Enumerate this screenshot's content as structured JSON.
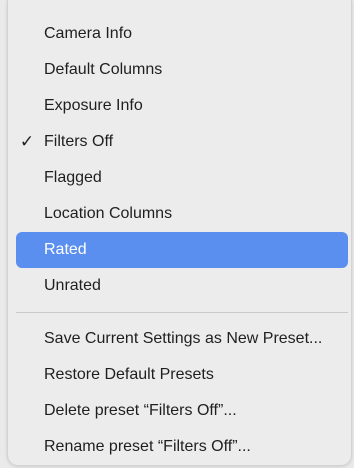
{
  "menu": {
    "section1": [
      {
        "label": "Camera Info",
        "checked": false
      },
      {
        "label": "Default Columns",
        "checked": false
      },
      {
        "label": "Exposure Info",
        "checked": false
      },
      {
        "label": "Filters Off",
        "checked": true
      },
      {
        "label": "Flagged",
        "checked": false
      },
      {
        "label": "Location Columns",
        "checked": false
      },
      {
        "label": "Rated",
        "checked": false,
        "highlighted": true
      },
      {
        "label": "Unrated",
        "checked": false
      }
    ],
    "section2": [
      {
        "label": "Save Current Settings as New Preset..."
      },
      {
        "label": "Restore Default Presets"
      },
      {
        "label": "Delete preset “Filters Off”..."
      },
      {
        "label": "Rename preset “Filters Off”..."
      }
    ],
    "check_mark": "✓",
    "highlight_color": "#5a8ff0"
  }
}
